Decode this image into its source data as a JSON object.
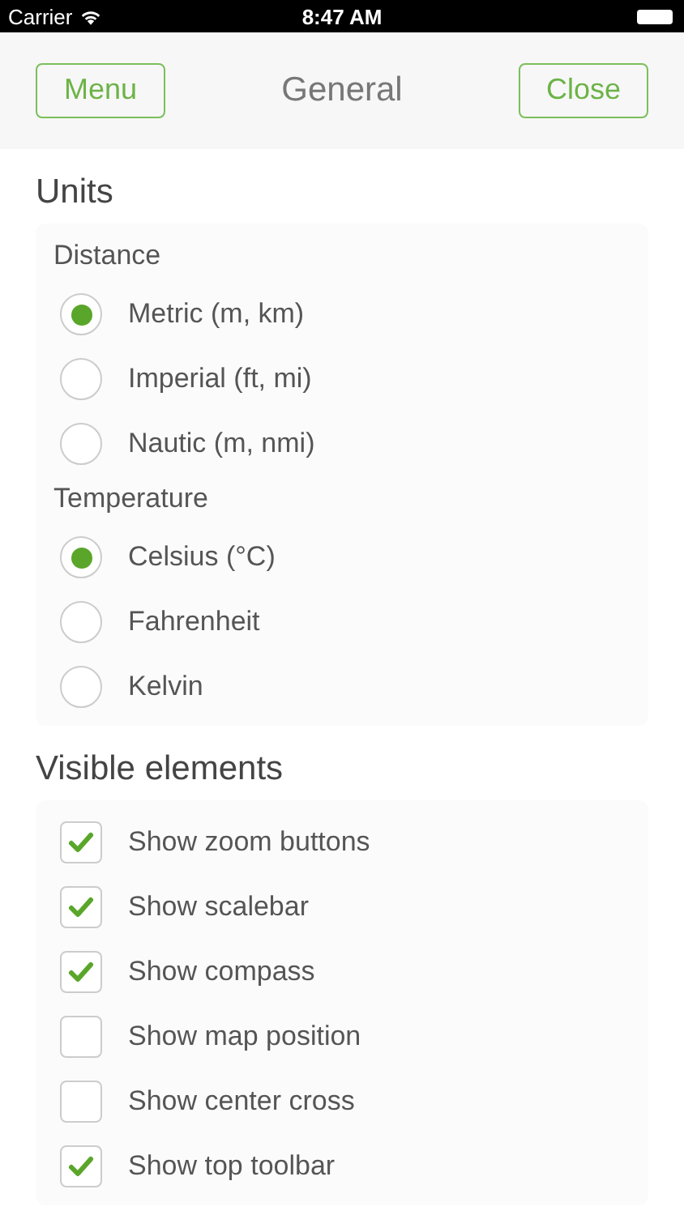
{
  "status_bar": {
    "carrier": "Carrier",
    "time": "8:47 AM"
  },
  "header": {
    "title": "General",
    "left_button": "Menu",
    "right_button": "Close"
  },
  "sections": [
    {
      "title": "Units",
      "kind": "radio",
      "groups": [
        {
          "label": "Distance",
          "options": [
            {
              "label": "Metric (m, km)",
              "selected": true
            },
            {
              "label": "Imperial (ft, mi)",
              "selected": false
            },
            {
              "label": "Nautic (m, nmi)",
              "selected": false
            }
          ]
        },
        {
          "label": "Temperature",
          "options": [
            {
              "label": "Celsius (°C)",
              "selected": true
            },
            {
              "label": "Fahrenheit",
              "selected": false
            },
            {
              "label": "Kelvin",
              "selected": false
            }
          ]
        }
      ]
    },
    {
      "title": "Visible elements",
      "kind": "checkbox",
      "groups": [
        {
          "options": [
            {
              "label": "Show zoom buttons",
              "checked": true
            },
            {
              "label": "Show scalebar",
              "checked": true
            },
            {
              "label": "Show compass",
              "checked": true
            },
            {
              "label": "Show map position",
              "checked": false
            },
            {
              "label": "Show center cross",
              "checked": false
            },
            {
              "label": "Show top toolbar",
              "checked": true
            }
          ]
        }
      ]
    }
  ]
}
